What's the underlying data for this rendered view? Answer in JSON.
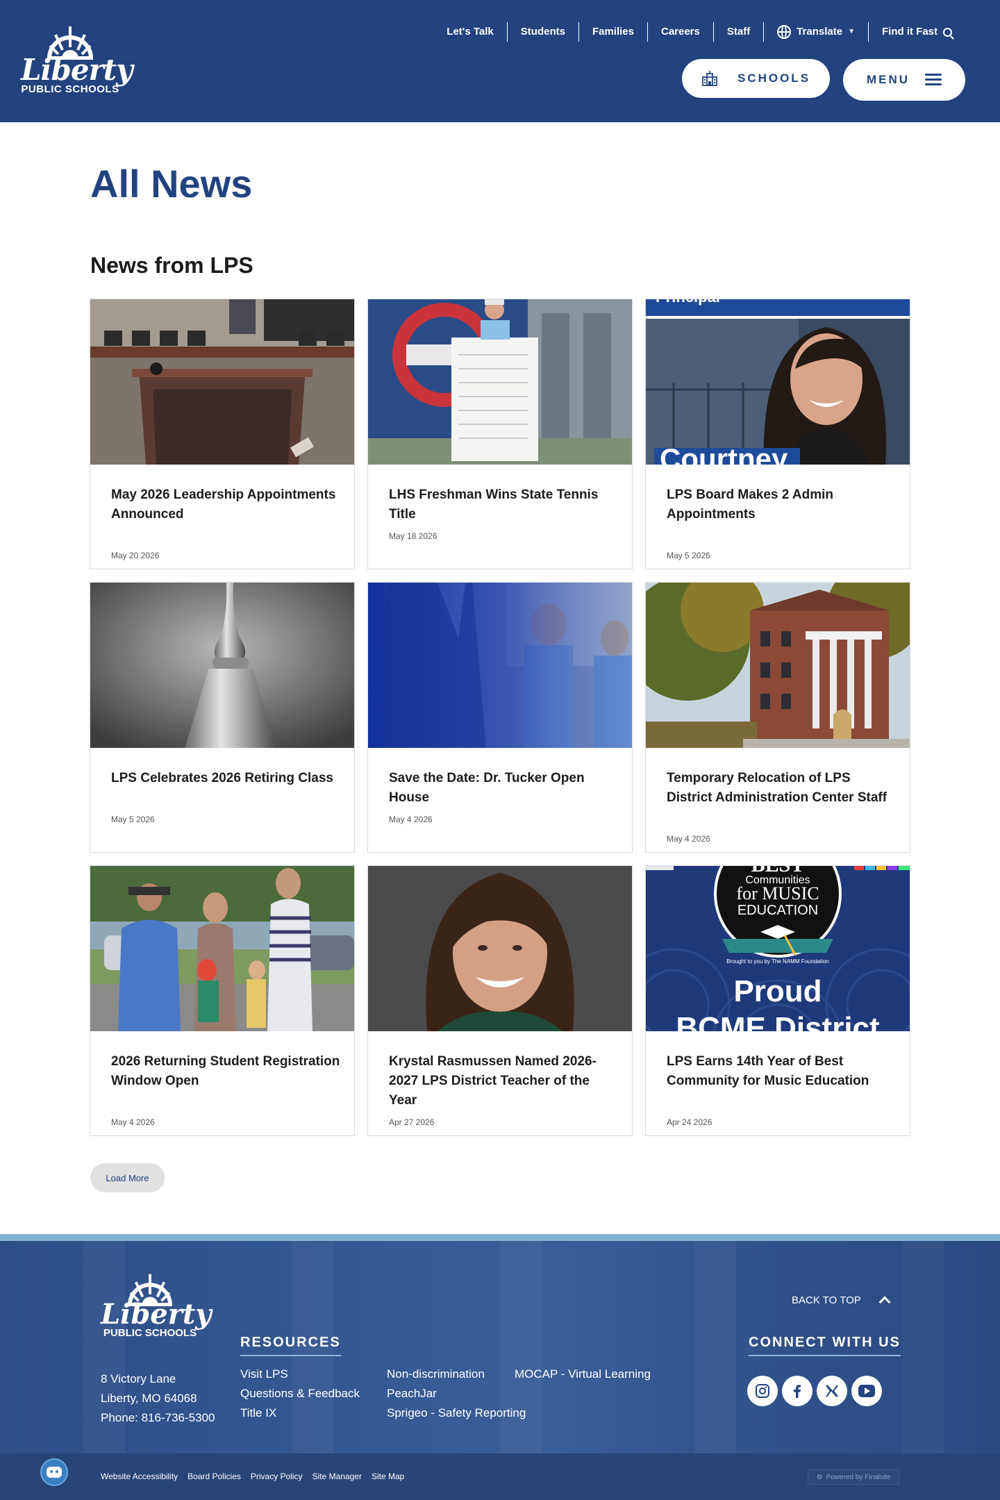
{
  "header": {
    "logo_text": "Liberty",
    "logo_subtext": "PUBLIC SCHOOLS",
    "utility_nav": [
      {
        "label": "Let's Talk"
      },
      {
        "label": "Students"
      },
      {
        "label": "Families"
      },
      {
        "label": "Careers"
      },
      {
        "label": "Staff"
      },
      {
        "label": "Translate",
        "icon": "globe-icon"
      },
      {
        "label": "Find it Fast",
        "icon": "search-icon"
      }
    ],
    "schools_button": "SCHOOLS",
    "menu_button": "MENU"
  },
  "page_title": "All News",
  "section_title": "News from LPS",
  "news": [
    {
      "title": "May 2026 Leadership Appointments Announced",
      "date": "May 20 2026"
    },
    {
      "title": "LHS Freshman Wins State Tennis Title",
      "date": "May 18 2026"
    },
    {
      "title": "LPS Board Makes 2 Admin Appointments",
      "date": "May 5 2026",
      "image_text_top": "Principal",
      "image_text_bottom": "Courtney"
    },
    {
      "title": "LPS Celebrates 2026 Retiring Class",
      "date": "May 5 2026"
    },
    {
      "title": "Save the Date: Dr. Tucker Open House",
      "date": "May 4 2026"
    },
    {
      "title": "Temporary Relocation of LPS District Administration Center Staff",
      "date": "May 4 2026"
    },
    {
      "title": "2026 Returning Student Registration Window Open",
      "date": "May 4 2026"
    },
    {
      "title": "Krystal Rasmussen Named 2026-2027 LPS District Teacher of the Year",
      "date": "Apr 27 2026"
    },
    {
      "title": "LPS Earns 14th Year of Best Community for Music Education",
      "date": "Apr 24 2026",
      "image_text": {
        "best": "BEST",
        "communities": "Communities",
        "for_music": "for MUSIC",
        "education": "EDUCATION",
        "brought": "Brought to you by The NAMM Foundation",
        "proud": "Proud",
        "district": "BCME District"
      }
    }
  ],
  "load_more": "Load More",
  "footer": {
    "logo_text": "Liberty",
    "logo_subtext": "PUBLIC SCHOOLS",
    "address": [
      "8 Victory Lane",
      "Liberty, MO  64068",
      "Phone: 816-736-5300"
    ],
    "resources_heading": "RESOURCES",
    "resources": [
      "Visit LPS",
      "Questions & Feedback",
      "Title IX",
      "Non-discrimination",
      "PeachJar",
      "Sprigeo - Safety Reporting",
      "MOCAP - Virtual Learning"
    ],
    "back_to_top": "BACK TO TOP",
    "connect_heading": "CONNECT WITH US",
    "social": [
      {
        "name": "instagram",
        "glyph": "◎"
      },
      {
        "name": "facebook",
        "glyph": "f"
      },
      {
        "name": "x",
        "glyph": "X"
      },
      {
        "name": "youtube",
        "glyph": "▶"
      }
    ],
    "bottom_links": [
      "Website Accessibility",
      "Board Policies",
      "Privacy Policy",
      "Site Manager",
      "Site Map"
    ],
    "powered_by": "Powered by Finalsite"
  },
  "colors": {
    "brand_blue": "#22437e",
    "accent_light_blue": "#7fb1d0"
  }
}
